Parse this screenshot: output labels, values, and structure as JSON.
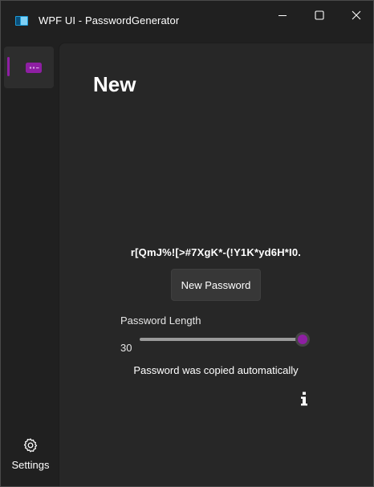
{
  "window": {
    "title": "WPF UI - PasswordGenerator",
    "accent_color": "#8e1fa3"
  },
  "titlebar": {
    "icons": [
      "app-icon",
      "minimize-icon",
      "maximize-icon",
      "close-icon"
    ]
  },
  "nav": {
    "items": [
      {
        "icon": "password-icon",
        "selected": true
      }
    ],
    "footer": {
      "settings_label": "Settings",
      "icon": "gear-icon"
    }
  },
  "page": {
    "title": "New",
    "password": "r[QmJ%![>#7XgK*-(!Y1K*yd6H*I0.",
    "new_password_button": "New Password",
    "length_label": "Password Length",
    "length_value": "30",
    "slider_fraction": 0.95,
    "copied_message": "Password was copied automatically",
    "info_icon": "info-icon"
  }
}
